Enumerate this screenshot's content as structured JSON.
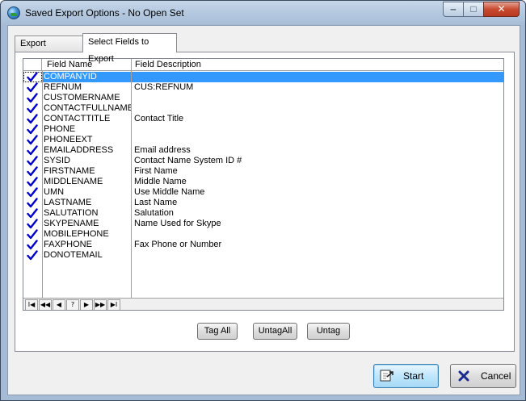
{
  "window": {
    "title": "Saved Export Options - No Open Set",
    "minimize_glyph": "‒",
    "maximize_glyph": "□",
    "close_glyph": "✕"
  },
  "tabs": [
    {
      "label": "Export Options",
      "active": false
    },
    {
      "label": "Select Fields to Export",
      "active": true
    }
  ],
  "grid": {
    "columns": [
      "",
      "Field Name",
      "Field Description"
    ],
    "check_color": "#0000cc",
    "selection_color": "#3399ff",
    "rows": [
      {
        "checked": true,
        "name": "COMPANYID",
        "description": "",
        "selected": true
      },
      {
        "checked": true,
        "name": "REFNUM",
        "description": "CUS:REFNUM",
        "selected": false
      },
      {
        "checked": true,
        "name": "CUSTOMERNAME",
        "description": "",
        "selected": false
      },
      {
        "checked": true,
        "name": "CONTACTFULLNAME",
        "description": "",
        "selected": false
      },
      {
        "checked": true,
        "name": "CONTACTTITLE",
        "description": "Contact Title",
        "selected": false
      },
      {
        "checked": true,
        "name": "PHONE",
        "description": "",
        "selected": false
      },
      {
        "checked": true,
        "name": "PHONEEXT",
        "description": "",
        "selected": false
      },
      {
        "checked": true,
        "name": "EMAILADDRESS",
        "description": "Email address",
        "selected": false
      },
      {
        "checked": true,
        "name": "SYSID",
        "description": "Contact Name System ID #",
        "selected": false
      },
      {
        "checked": true,
        "name": "FIRSTNAME",
        "description": "First Name",
        "selected": false
      },
      {
        "checked": true,
        "name": "MIDDLENAME",
        "description": "Middle Name",
        "selected": false
      },
      {
        "checked": true,
        "name": "UMN",
        "description": "Use Middle Name",
        "selected": false
      },
      {
        "checked": true,
        "name": "LASTNAME",
        "description": "Last Name",
        "selected": false
      },
      {
        "checked": true,
        "name": "SALUTATION",
        "description": "Salutation",
        "selected": false
      },
      {
        "checked": true,
        "name": "SKYPENAME",
        "description": "Name Used for Skype",
        "selected": false
      },
      {
        "checked": true,
        "name": "MOBILEPHONE",
        "description": "",
        "selected": false
      },
      {
        "checked": true,
        "name": "FAXPHONE",
        "description": "Fax Phone or Number",
        "selected": false
      },
      {
        "checked": true,
        "name": "DONOTEMAIL",
        "description": "",
        "selected": false
      }
    ]
  },
  "navigator": [
    {
      "name": "first-record-button",
      "glyph": "I◀"
    },
    {
      "name": "prev-page-button",
      "glyph": "◀◀"
    },
    {
      "name": "prev-record-button",
      "glyph": "◀"
    },
    {
      "name": "query-button",
      "glyph": "?"
    },
    {
      "name": "next-record-button",
      "glyph": "▶"
    },
    {
      "name": "next-page-button",
      "glyph": "▶▶"
    },
    {
      "name": "last-record-button",
      "glyph": "▶I"
    }
  ],
  "buttons": {
    "tag_all": "Tag All",
    "untag_all": "UntagAll",
    "untag": "Untag",
    "start": "Start",
    "cancel": "Cancel"
  },
  "icons": {
    "app": "globe-icon",
    "start": "export-arrow-icon",
    "cancel": "x-icon",
    "check": "checkmark-icon",
    "cancel_color": "#1a2a8c"
  }
}
